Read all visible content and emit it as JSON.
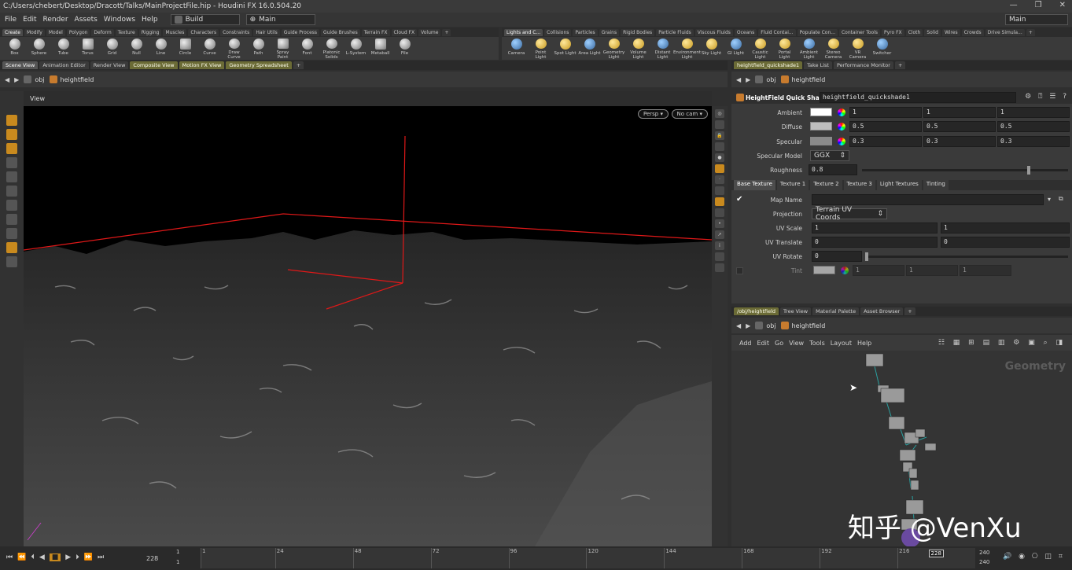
{
  "window": {
    "title": "C:/Users/chebert/Desktop/Dracott/Talks/MainProjectFile.hip - Houdini FX 16.0.504.20",
    "buttons": [
      "—",
      "❐",
      "✕"
    ]
  },
  "menu": {
    "items": [
      "File",
      "Edit",
      "Render",
      "Assets",
      "Windows",
      "Help"
    ],
    "desktop": "Build",
    "context": "Main",
    "right_context": "Main"
  },
  "shelf_left": {
    "tabs": [
      "Create",
      "Modify",
      "Model",
      "Polygon",
      "Deform",
      "Texture",
      "Rigging",
      "Muscles",
      "Characters",
      "Constraints",
      "Hair Utils",
      "Guide Process",
      "Guide Brushes",
      "Terrain FX",
      "Cloud FX",
      "Volume"
    ],
    "tools": [
      "Box",
      "Sphere",
      "Tube",
      "Torus",
      "Grid",
      "Null",
      "Line",
      "Circle",
      "Curve",
      "Draw Curve",
      "Path",
      "Spray Paint",
      "Font",
      "Platonic Solids",
      "L-System",
      "Metaball",
      "File"
    ]
  },
  "shelf_right": {
    "tabs": [
      "Lights and C...",
      "Collisions",
      "Particles",
      "Grains",
      "Rigid Bodies",
      "Particle Fluids",
      "Viscous Fluids",
      "Oceans",
      "Fluid Contai...",
      "Populate Con...",
      "Container Tools",
      "Pyro FX",
      "Cloth",
      "Solid",
      "Wires",
      "Crowds",
      "Drive Simula..."
    ],
    "tools": [
      "Camera",
      "Point Light",
      "Spot Light",
      "Area Light",
      "Geometry Light",
      "Volume Light",
      "Distant Light",
      "Environment Light",
      "Sky Light",
      "GI Light",
      "Caustic Light",
      "Portal Light",
      "Ambient Light",
      "Stereo Camera",
      "VR Camera",
      "Switcher"
    ]
  },
  "left_pane": {
    "tabs": [
      "Scene View",
      "Animation Editor",
      "Render View",
      "Composite View",
      "Motion FX View",
      "Geometry Spreadsheet"
    ],
    "path": [
      "obj",
      "heightfield"
    ],
    "view_label": "View",
    "persp": "Persp ▾",
    "cam": "No cam ▾"
  },
  "params_pane": {
    "tabs": [
      "heightfield_quickshade1",
      "Take List",
      "Performance Monitor"
    ],
    "path": [
      "obj",
      "heightfield"
    ],
    "node_type": "HeightField Quick Shade",
    "node_name": "heightfield_quickshade1",
    "ambient": {
      "label": "Ambient",
      "v": [
        "1",
        "1",
        "1"
      ]
    },
    "diffuse": {
      "label": "Diffuse",
      "v": [
        "0.5",
        "0.5",
        "0.5"
      ]
    },
    "specular": {
      "label": "Specular",
      "v": [
        "0.3",
        "0.3",
        "0.3"
      ]
    },
    "specular_model": {
      "label": "Specular Model",
      "value": "GGX"
    },
    "roughness": {
      "label": "Roughness",
      "value": "0.8"
    },
    "subtabs": [
      "Base Texture",
      "Texture 1",
      "Texture 2",
      "Texture 3",
      "Light Textures",
      "Tinting"
    ],
    "map_name": {
      "label": "Map Name",
      "value": ""
    },
    "projection": {
      "label": "Projection",
      "value": "Terrain UV Coords"
    },
    "uv_scale": {
      "label": "UV Scale",
      "v": [
        "1",
        "1"
      ]
    },
    "uv_translate": {
      "label": "UV Translate",
      "v": [
        "0",
        "0"
      ]
    },
    "uv_rotate": {
      "label": "UV Rotate",
      "value": "0"
    },
    "tint": {
      "label": "Tint",
      "v": [
        "1",
        "1",
        "1"
      ]
    }
  },
  "net_pane": {
    "tabs": [
      "/obj/heightfield",
      "Tree View",
      "Material Palette",
      "Asset Browser"
    ],
    "path": [
      "obj",
      "heightfield"
    ],
    "menu": [
      "Add",
      "Edit",
      "Go",
      "View",
      "Tools",
      "Layout",
      "Help"
    ],
    "context_label": "Geometry"
  },
  "timeline": {
    "frame": "228",
    "start": "1",
    "start2": "1",
    "ticks": [
      "1",
      "24",
      "48",
      "72",
      "96",
      "120",
      "144",
      "168",
      "192",
      "216"
    ],
    "current_marker": "228",
    "end": "240",
    "end2": "240"
  },
  "watermark": "知乎 @VenXu",
  "colors": {
    "accent": "#c98a1e",
    "gizmo": "#e01818"
  }
}
